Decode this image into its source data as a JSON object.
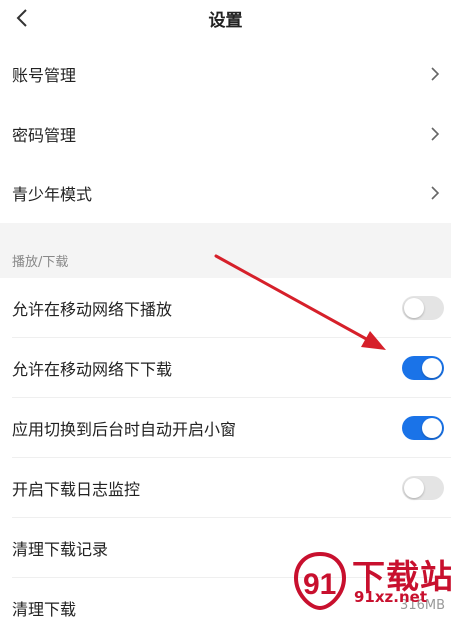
{
  "header": {
    "title": "设置"
  },
  "account_items": [
    {
      "label": "账号管理"
    },
    {
      "label": "密码管理"
    },
    {
      "label": "青少年模式"
    }
  ],
  "section": {
    "title": "播放/下载"
  },
  "toggles": [
    {
      "label": "允许在移动网络下播放",
      "on": false
    },
    {
      "label": "允许在移动网络下下载",
      "on": true
    },
    {
      "label": "应用切换到后台时自动开启小窗",
      "on": true
    },
    {
      "label": "开启下载日志监控",
      "on": false
    }
  ],
  "clear_items": [
    {
      "label": "清理下载记录"
    },
    {
      "label": "清理下载",
      "size": "316MB"
    }
  ],
  "watermark": {
    "title": "下载站",
    "site": "91xz.net"
  },
  "colors": {
    "accent": "#1a73e8",
    "toggle_off": "#e4e4e4",
    "arrow": "#d6202a",
    "watermark": "#c8102e"
  }
}
